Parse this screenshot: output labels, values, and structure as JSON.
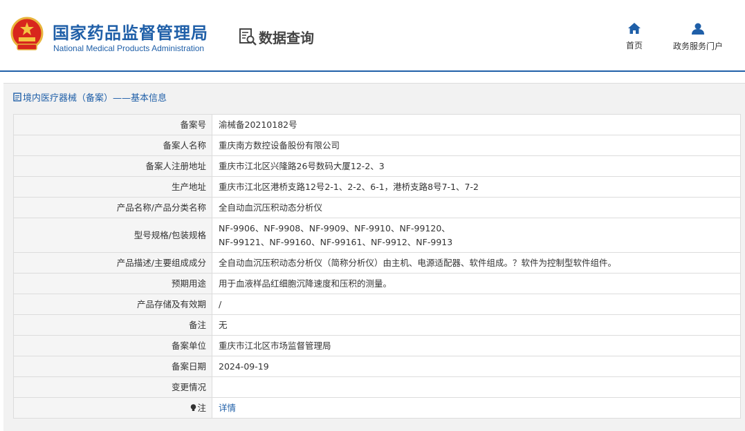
{
  "header": {
    "title": "国家药品监督管理局",
    "subtitle": "National Medical Products Administration",
    "query_label": "数据查询",
    "nav": [
      {
        "label": "首页",
        "icon": "home-icon"
      },
      {
        "label": "政务服务门户",
        "icon": "user-icon"
      }
    ]
  },
  "section": {
    "title": "境内医疗器械（备案）——基本信息"
  },
  "colors": {
    "brand_blue": "#1f5fa8",
    "label_bg": "#f5f5f5",
    "border": "#dcdcdc"
  },
  "record": {
    "rows": [
      {
        "label": "备案号",
        "value": "渝械备20210182号"
      },
      {
        "label": "备案人名称",
        "value": "重庆南方数控设备股份有限公司"
      },
      {
        "label": "备案人注册地址",
        "value": "重庆市江北区兴隆路26号数码大厦12-2、3"
      },
      {
        "label": "生产地址",
        "value": "重庆市江北区港桥支路12号2-1、2-2、6-1，港桥支路8号7-1、7-2"
      },
      {
        "label": "产品名称/产品分类名称",
        "value": "全自动血沉压积动态分析仪"
      },
      {
        "label": "型号规格/包装规格",
        "value_line1": "NF-9906、NF-9908、NF-9909、NF-9910、NF-99120、",
        "value_line2": "NF-99121、NF-99160、NF-99161、NF-9912、NF-9913"
      },
      {
        "label": "产品描述/主要组成成分",
        "value": "全自动血沉压积动态分析仪（简称分析仪）由主机、电源适配器、软件组成。？软件为控制型软件组件。"
      },
      {
        "label": "预期用途",
        "value": "用于血液样品红细胞沉降速度和压积的测量。"
      },
      {
        "label": "产品存储及有效期",
        "value": "/"
      },
      {
        "label": "备注",
        "value": "无"
      },
      {
        "label": "备案单位",
        "value": "重庆市江北区市场监督管理局"
      },
      {
        "label": "备案日期",
        "value": "2024-09-19"
      },
      {
        "label": "变更情况",
        "value": ""
      },
      {
        "label": "注",
        "value": "详情"
      }
    ]
  }
}
